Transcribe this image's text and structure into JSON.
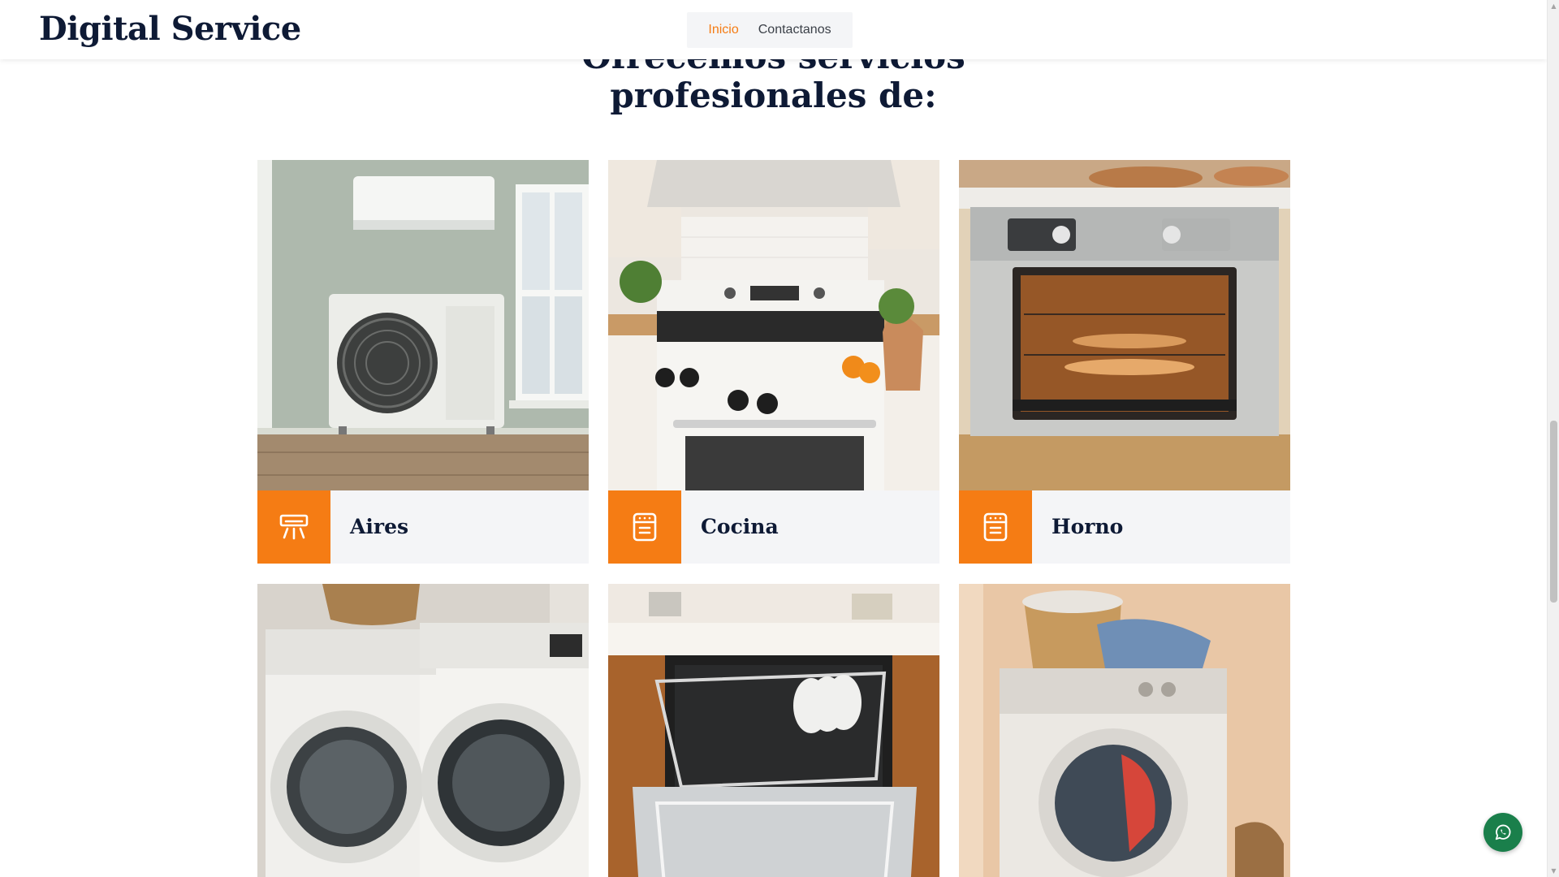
{
  "header": {
    "brand": "Digital Service",
    "nav": [
      {
        "label": "Inicio",
        "active": true
      },
      {
        "label": "Contactanos",
        "active": false
      }
    ]
  },
  "section": {
    "title_line1": "Ofrecemos servicios",
    "title_line2": "profesionales de:"
  },
  "services": [
    {
      "label": "Aires",
      "icon": "air-conditioner-icon"
    },
    {
      "label": "Cocina",
      "icon": "stove-icon"
    },
    {
      "label": "Horno",
      "icon": "oven-icon"
    }
  ],
  "service_photos": [
    "air-conditioner-photo",
    "kitchen-stove-photo",
    "oven-photo",
    "washer-dryer-photo",
    "dishwasher-photo",
    "washing-machine-photo"
  ],
  "colors": {
    "accent": "#f57c14",
    "heading": "#0e1a35",
    "caption_bg": "#f4f5f7",
    "whatsapp": "#1a7f4b"
  },
  "floating_button": {
    "icon": "whatsapp-icon"
  }
}
